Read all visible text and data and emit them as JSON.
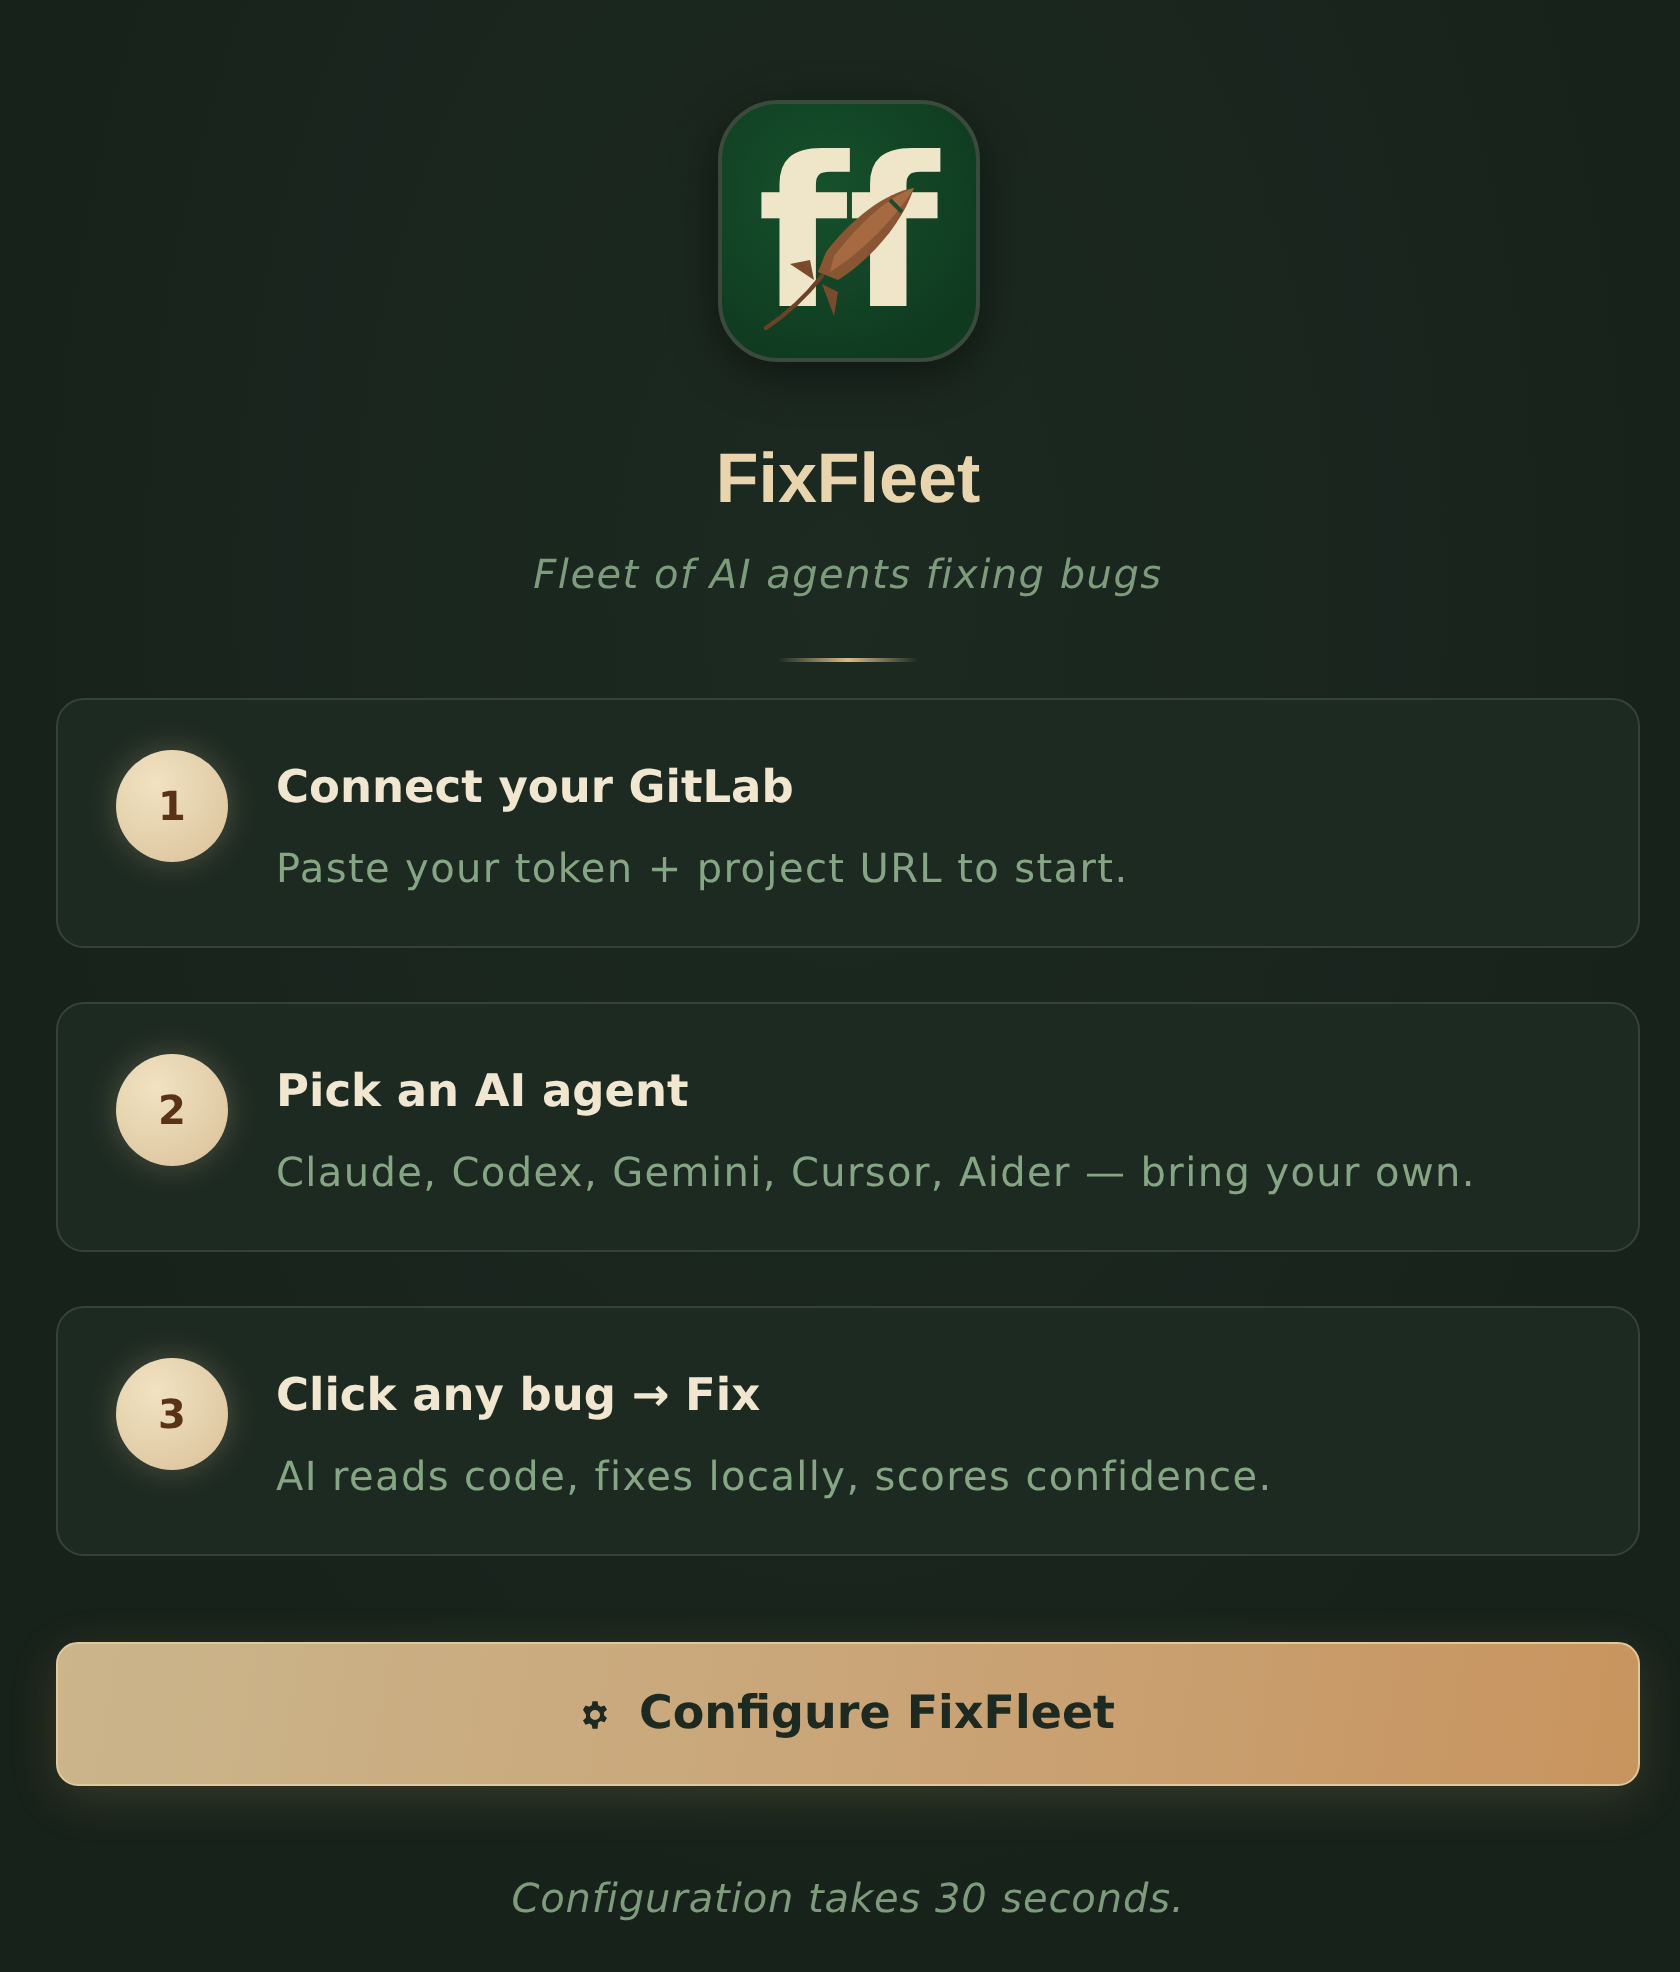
{
  "logo": {
    "letters": "ff"
  },
  "app": {
    "title": "FixFleet",
    "tagline": "Fleet of AI agents fixing bugs"
  },
  "steps": [
    {
      "number": "1",
      "title": "Connect your GitLab",
      "description": "Paste your token + project URL to start."
    },
    {
      "number": "2",
      "title": "Pick an AI agent",
      "description": "Claude, Codex, Gemini, Cursor, Aider — bring your own."
    },
    {
      "number": "3",
      "title": "Click any bug → Fix",
      "description": "AI reads code, fixes locally, scores confidence."
    }
  ],
  "primary_button": {
    "label": "Configure FixFleet"
  },
  "footnote": "Configuration takes 30 seconds."
}
